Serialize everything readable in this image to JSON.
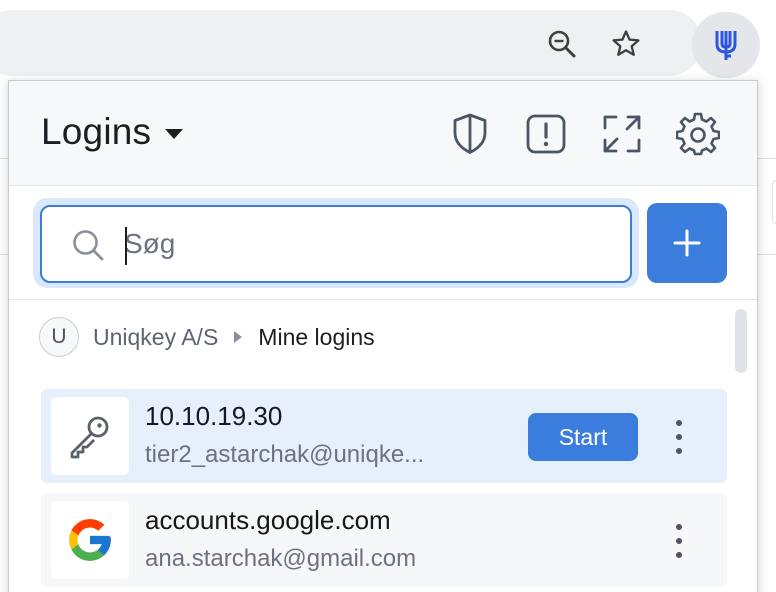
{
  "browser": {
    "zoom_icon": "zoom-out-icon",
    "bookmark_icon": "star-icon",
    "extension_icon": "uniqkey-icon"
  },
  "popup": {
    "title": "Logins",
    "header_icons": [
      "shield-icon",
      "alert-icon",
      "expand-icon",
      "gear-icon"
    ],
    "search": {
      "placeholder": "Søg",
      "value": ""
    },
    "breadcrumb": {
      "avatar_letter": "U",
      "organization": "Uniqkey A/S",
      "current": "Mine logins"
    },
    "logins": [
      {
        "title": "10.10.19.30",
        "subtitle": "tier2_astarchak@uniqke...",
        "icon": "key-icon",
        "action": "Start",
        "selected": true
      },
      {
        "title": "accounts.google.com",
        "subtitle": "ana.starchak@gmail.com",
        "icon": "google-logo-icon",
        "selected": false
      }
    ],
    "colors": {
      "accent": "#3b7ddd",
      "selected_row": "#e6effc"
    }
  }
}
